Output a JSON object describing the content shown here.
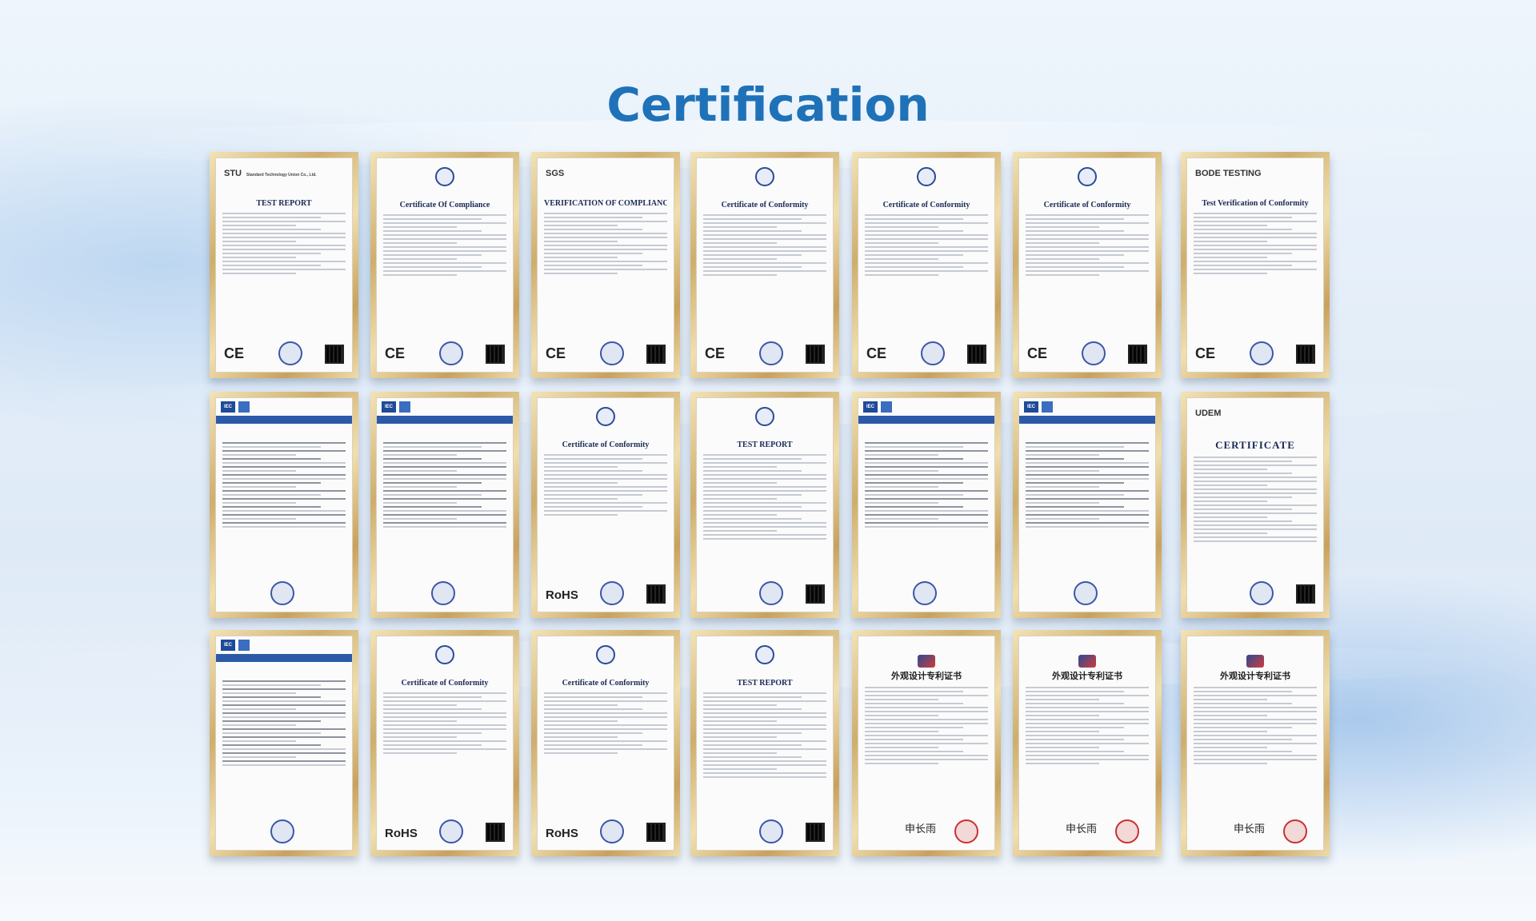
{
  "page": {
    "title": "Certification"
  },
  "certificates": [
    {
      "kind": "report",
      "title": "TEST REPORT",
      "logo": "STU",
      "org": "Standard Technology Union Co., Ltd.",
      "mark": "CE"
    },
    {
      "kind": "compliance",
      "title": "Certificate Of Compliance",
      "logo": "",
      "org": "",
      "mark": "CE"
    },
    {
      "kind": "sgs",
      "title": "VERIFICATION OF COMPLIANCE",
      "logo": "SGS",
      "org": "",
      "mark": "CE"
    },
    {
      "kind": "conformity",
      "title": "Certificate of Conformity",
      "logo": "",
      "org": "",
      "mark": "CE"
    },
    {
      "kind": "conformity",
      "title": "Certificate of Conformity",
      "logo": "",
      "org": "",
      "mark": "CE"
    },
    {
      "kind": "conformity",
      "title": "Certificate of Conformity",
      "logo": "",
      "org": "",
      "mark": "CE"
    },
    {
      "kind": "bode",
      "title": "Test Verification of Conformity",
      "logo": "BODE TESTING",
      "org": "",
      "mark": "CE"
    },
    {
      "kind": "iec",
      "title": "",
      "logo": "IEC",
      "org": "",
      "mark": ""
    },
    {
      "kind": "iec",
      "title": "",
      "logo": "IEC",
      "org": "",
      "mark": ""
    },
    {
      "kind": "conformity",
      "title": "Certificate of Conformity",
      "logo": "",
      "org": "",
      "mark": "RoHS"
    },
    {
      "kind": "report",
      "title": "TEST REPORT",
      "logo": "",
      "org": "",
      "mark": ""
    },
    {
      "kind": "iec",
      "title": "",
      "logo": "IEC",
      "org": "",
      "mark": ""
    },
    {
      "kind": "iec",
      "title": "",
      "logo": "IEC",
      "org": "",
      "mark": ""
    },
    {
      "kind": "udem",
      "title": "CERTIFICATE",
      "logo": "UDEM",
      "org": "",
      "mark": ""
    },
    {
      "kind": "iec",
      "title": "",
      "logo": "IEC",
      "org": "",
      "mark": ""
    },
    {
      "kind": "conformity",
      "title": "Certificate of Conformity",
      "logo": "",
      "org": "",
      "mark": "RoHS"
    },
    {
      "kind": "conformity",
      "title": "Certificate of Conformity",
      "logo": "",
      "org": "",
      "mark": "RoHS"
    },
    {
      "kind": "report",
      "title": "TEST REPORT",
      "logo": "",
      "org": "",
      "mark": ""
    },
    {
      "kind": "patent",
      "title": "外观设计专利证书",
      "logo": "",
      "org": "",
      "mark": ""
    },
    {
      "kind": "patent",
      "title": "外观设计专利证书",
      "logo": "",
      "org": "",
      "mark": ""
    },
    {
      "kind": "patent",
      "title": "外观设计专利证书",
      "logo": "",
      "org": "",
      "mark": ""
    }
  ]
}
